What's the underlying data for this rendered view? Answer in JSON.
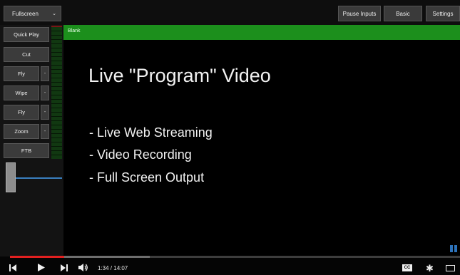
{
  "toolbar": {
    "fullscreen_label": "Fullscreen",
    "fullscreen_caret": "⌄",
    "pause_inputs_label": "Pause Inputs",
    "basic_label": "Basic",
    "settings_label": "Settings"
  },
  "transitions": {
    "quick_play": "Quick Play",
    "cut": "Cut",
    "fly1": "Fly",
    "wipe": "Wipe",
    "fly2": "Fly",
    "zoom": "Zoom",
    "ftb": "FTB",
    "dropdown_caret": "-"
  },
  "program": {
    "input_name": "Blank",
    "title": "Live \"Program\" Video",
    "bullets": [
      "- Live Web Streaming",
      "- Video Recording",
      "- Full Screen Output"
    ]
  },
  "player": {
    "played_fraction": 0.12,
    "buffered_fraction": 0.31,
    "time_display": "1:34 / 14:07",
    "icons": [
      "skip-back-icon",
      "play-icon",
      "skip-next-icon",
      "volume-icon",
      "captions-icon",
      "gear-icon",
      "theater-mode-icon"
    ],
    "cc_label": "CC"
  },
  "colors": {
    "program_header": "#1c8f1c",
    "progress_played": "#e22020",
    "tbar_accent": "#3a7fbf"
  }
}
